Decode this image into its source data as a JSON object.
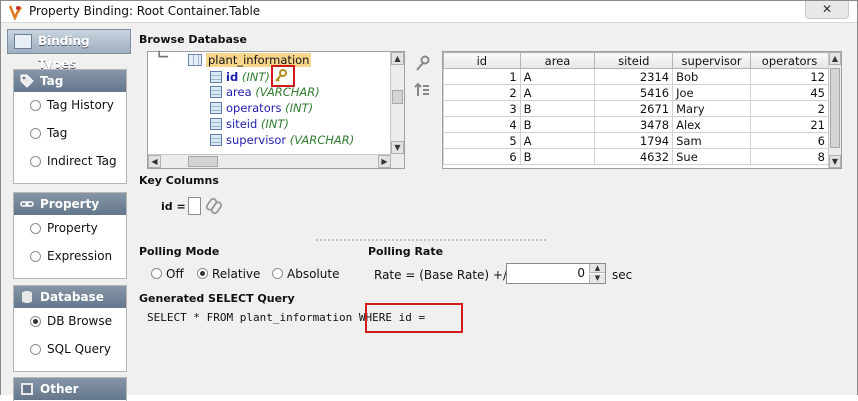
{
  "window": {
    "title": "Property Binding: Root Container.Table",
    "close_label": "✕"
  },
  "sidebar": {
    "header": "Binding Types",
    "groups": [
      {
        "label": "Tag",
        "icon": "tag-icon",
        "items": [
          {
            "label": "Tag History",
            "selected": false
          },
          {
            "label": "Tag",
            "selected": false
          },
          {
            "label": "Indirect Tag",
            "selected": false
          }
        ]
      },
      {
        "label": "Property",
        "icon": "chain-link-icon",
        "items": [
          {
            "label": "Property",
            "selected": false
          },
          {
            "label": "Expression",
            "selected": false
          }
        ]
      },
      {
        "label": "Database",
        "icon": "database-icon",
        "items": [
          {
            "label": "DB Browse",
            "selected": true
          },
          {
            "label": "SQL Query",
            "selected": false
          }
        ]
      },
      {
        "label": "Other",
        "icon": "other-icon",
        "items": []
      }
    ]
  },
  "browse": {
    "label": "Browse Database",
    "table_name": "plant_information",
    "columns": [
      {
        "name": "id",
        "type": "(INT)",
        "is_key": true
      },
      {
        "name": "area",
        "type": "(VARCHAR)",
        "is_key": false
      },
      {
        "name": "operators",
        "type": "(INT)",
        "is_key": false
      },
      {
        "name": "siteid",
        "type": "(INT)",
        "is_key": false
      },
      {
        "name": "supervisor",
        "type": "(VARCHAR)",
        "is_key": false
      }
    ]
  },
  "preview": {
    "headers": [
      "id",
      "area",
      "siteid",
      "supervisor",
      "operators"
    ],
    "rows": [
      [
        "1",
        "A",
        "2314",
        "Bob",
        "12"
      ],
      [
        "2",
        "A",
        "5416",
        "Joe",
        "45"
      ],
      [
        "3",
        "B",
        "2671",
        "Mary",
        "2"
      ],
      [
        "4",
        "B",
        "3478",
        "Alex",
        "21"
      ],
      [
        "5",
        "A",
        "1794",
        "Sam",
        "6"
      ],
      [
        "6",
        "B",
        "4632",
        "Sue",
        "8"
      ]
    ]
  },
  "key_columns": {
    "label": "Key Columns",
    "field_label": "id ="
  },
  "polling": {
    "mode_label": "Polling Mode",
    "options": [
      "Off",
      "Relative",
      "Absolute"
    ],
    "selected": "Relative",
    "rate_label": "Polling Rate",
    "rate_prefix": "Rate = (Base Rate) +/-",
    "rate_value": "0",
    "rate_unit": "sec"
  },
  "query": {
    "label": "Generated SELECT Query",
    "text": "SELECT * FROM plant_information WHERE id ="
  },
  "colors": {
    "highlight_red": "#d11a1a",
    "column_blue": "#2020b0",
    "type_green": "#2f7d2f",
    "selection_orange": "#f7d68c"
  }
}
